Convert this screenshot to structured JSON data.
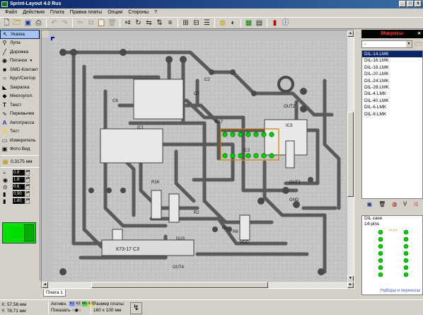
{
  "window": {
    "title": "Sprint-Layout 4.0 Rus",
    "controls": [
      "_",
      "□",
      "x"
    ]
  },
  "menu": [
    "Файл",
    "Действия",
    "Плата",
    "Правка платы",
    "Опции",
    "Стороны",
    "?"
  ],
  "toolbar_icons": [
    "new-icon",
    "open-icon",
    "save-icon",
    "print-icon",
    "undo-icon",
    "redo-icon",
    "cut-icon",
    "copy-icon",
    "paste-icon",
    "delete-icon",
    "x2-icon",
    "rotate-icon",
    "mirror-h-icon",
    "mirror-v-icon",
    "align-icon",
    "group-icon",
    "ungroup-icon",
    "layer-icon",
    "zoom-icon",
    "pacman-icon",
    "drc-icon",
    "fotoview-icon",
    "battery-icon",
    "info-icon"
  ],
  "tools": [
    {
      "label": "Указка",
      "icon": "pointer-icon",
      "glyph": "↖",
      "active": true
    },
    {
      "label": "Лупа",
      "icon": "magnifier-icon",
      "glyph": "⚲"
    },
    {
      "label": "Дорожка",
      "icon": "track-icon",
      "glyph": "╱"
    },
    {
      "label": "Пятачок",
      "icon": "pad-icon",
      "glyph": "◉"
    },
    {
      "label": "SMD-Контакт",
      "icon": "smd-icon",
      "glyph": "■"
    },
    {
      "label": "Круг/Сектор",
      "icon": "circle-icon",
      "glyph": "○"
    },
    {
      "label": "Закраска",
      "icon": "fill-icon",
      "glyph": "◣"
    },
    {
      "label": "Многоугол.",
      "icon": "polygon-icon",
      "glyph": "◆"
    },
    {
      "label": "Текст",
      "icon": "text-icon",
      "glyph": "T"
    },
    {
      "label": "Перемычки",
      "icon": "jumper-icon",
      "glyph": "∿"
    },
    {
      "label": "Автотрасса",
      "icon": "autoroute-icon",
      "glyph": "A"
    },
    {
      "label": "Тест",
      "icon": "test-icon",
      "glyph": "⚡"
    },
    {
      "label": "Измеритель",
      "icon": "ruler-icon",
      "glyph": "▭"
    },
    {
      "label": "Фото Вид",
      "icon": "photo-icon",
      "glyph": "▣"
    }
  ],
  "grid": "0,3175 мм",
  "params": [
    {
      "icon": "track-width-icon",
      "glyph": "÷",
      "value": "0.8"
    },
    {
      "icon": "pad-outer-icon",
      "glyph": "◉",
      "value": "1.8"
    },
    {
      "icon": "pad-inner-icon",
      "glyph": "⊙",
      "value": "0.6"
    },
    {
      "icon": "smd-w-icon",
      "glyph": "▮",
      "value": "0.90"
    },
    {
      "icon": "smd-h-icon",
      "glyph": "▮",
      "value": "1.80"
    }
  ],
  "layer_tab": "Плата 1",
  "macros": {
    "title": "Макросы",
    "combo_value": "..",
    "items": [
      "DIL-14.LMK",
      "DIL-16.LMK",
      "DIL-18.LMK",
      "DIL-20.LMK",
      "DIL-24.LMK",
      "DIL-28.LMK",
      "DIL-4.LMK",
      "DIL-40.LMK",
      "DIL-6.LMK",
      "DIL-8.LMK"
    ],
    "selected": 0,
    "tool_icons": [
      "save-icon",
      "delete-icon",
      "settings-icon",
      "fork-icon",
      "shuffle-icon"
    ],
    "preview_line1": "DIL case",
    "preview_line2": "14-pins",
    "preview_footer": "Наборы и переносы"
  },
  "status": {
    "x": "X: 57,56 мм",
    "y": "Y: 78,71 мм",
    "active_label": "Активн.",
    "show_label": "Показать",
    "layer_chips": [
      "K1",
      "K2",
      "M1",
      "M2"
    ],
    "size_label": "Размер платы:",
    "size_value": "160 x 100 мм"
  },
  "colors": {
    "accent": "#0a246a",
    "titlebar_end": "#3a6ea5",
    "macro_title": "#ff3030",
    "pad_green": "#00d000",
    "copper_gray": "#5a5a5a"
  },
  "pcb_labels": [
    "IC1",
    "IC2",
    "IC3",
    "OUT1",
    "OUT2",
    "OUT4",
    "DU3",
    "VCC",
    "GND",
    "К73-17 C3",
    "R2",
    "R5",
    "R6",
    "C6",
    "C7",
    "R16",
    "R17",
    "C2"
  ]
}
